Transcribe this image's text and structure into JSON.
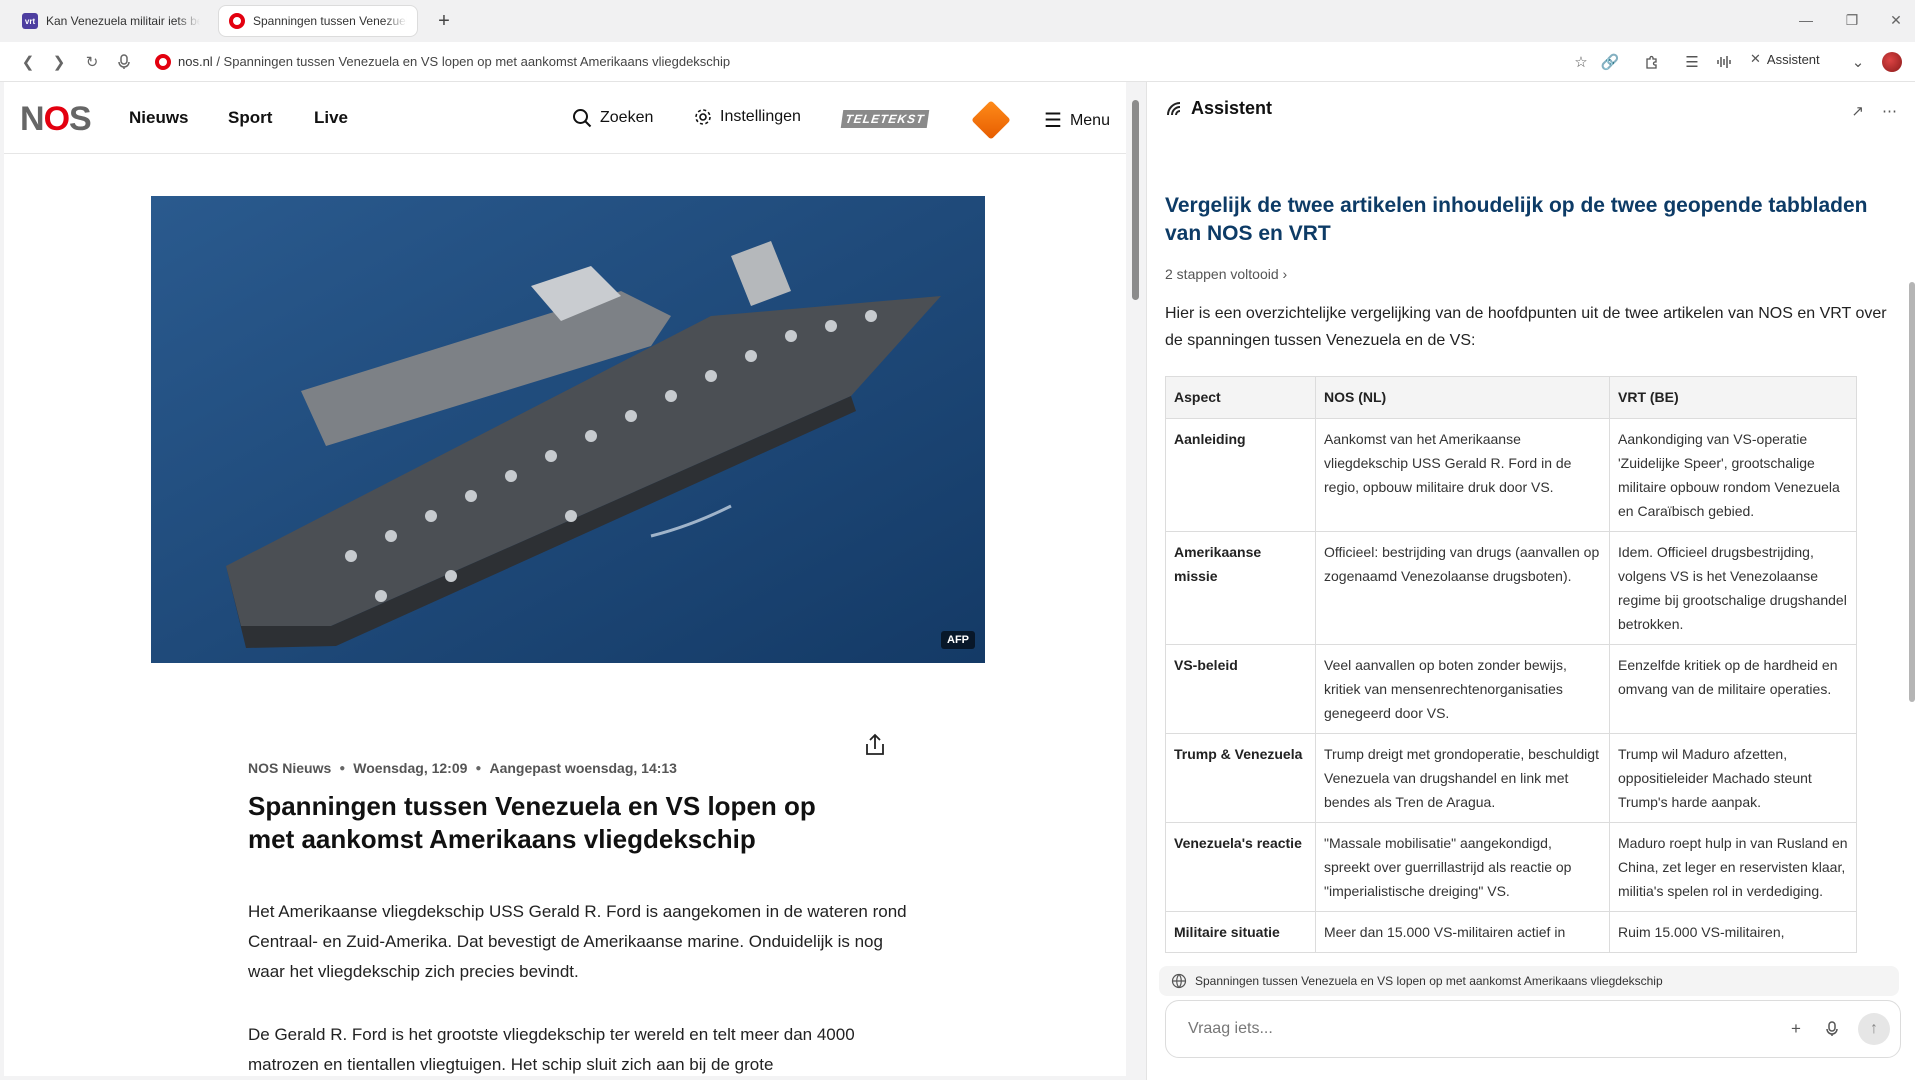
{
  "tabs": [
    {
      "title": "Kan Venezuela militair iets be",
      "favicon": "vrt-favicon-icon"
    },
    {
      "title": "Spanningen tussen Venezuela",
      "favicon": "nos-favicon-icon"
    }
  ],
  "address": {
    "host": "nos.nl",
    "path": " / Spanningen tussen Venezuela en VS lopen op met aankomst Amerikaans vliegdekschip"
  },
  "toolbar": {
    "assistant_label": "Assistent"
  },
  "nos": {
    "logo_left": "N",
    "logo_o": "O",
    "logo_right": "S",
    "nav": [
      "Nieuws",
      "Sport",
      "Live"
    ],
    "search_label": "Zoeken",
    "settings_label": "Instellingen",
    "teletekst_label": "TELETEKST",
    "menu_label": "Menu",
    "image_credit": "AFP",
    "meta_source": "NOS Nieuws",
    "meta_date": "Woensdag, 12:09",
    "meta_updated": "Aangepast woensdag, 14:13",
    "headline": "Spanningen tussen Venezuela en VS lopen op met aankomst Amerikaans vliegdekschip",
    "paragraphs": [
      "Het Amerikaanse vliegdekschip USS Gerald R. Ford is aangekomen in de wateren rond Centraal- en Zuid-Amerika. Dat bevestigt de Amerikaanse marine. Onduidelijk is nog waar het vliegdekschip zich precies bevindt.",
      "De Gerald R. Ford is het grootste vliegdekschip ter wereld en telt meer dan 4000 matrozen en tientallen vliegtuigen. Het schip sluit zich aan bij de grote"
    ]
  },
  "assistant": {
    "title": "Assistent",
    "question": "Vergelijk de twee artikelen inhoudelijk op de twee geopende tabbladen van NOS en VRT",
    "steps": "2 stappen voltooid",
    "intro": "Hier is een overzichtelijke vergelijking van de hoofdpunten uit de twee artikelen van NOS en VRT over de spanningen tussen Venezuela en de VS:",
    "table_headers": [
      "Aspect",
      "NOS (NL)",
      "VRT (BE)"
    ],
    "rows": [
      {
        "aspect": "Aanleiding",
        "nos": "Aankomst van het Amerikaanse vliegdekschip USS Gerald R. Ford in de regio, opbouw militaire druk door VS.",
        "vrt": "Aankondiging van VS-operatie 'Zuidelijke Speer', grootschalige militaire opbouw rondom Venezuela en Caraïbisch gebied."
      },
      {
        "aspect": "Amerikaanse missie",
        "nos": "Officieel: bestrijding van drugs (aanvallen op zogenaamd Venezolaanse drugsboten).",
        "vrt": "Idem. Officieel drugsbestrijding, volgens VS is het Venezolaanse regime bij grootschalige drugshandel betrokken."
      },
      {
        "aspect": "VS-beleid",
        "nos": "Veel aanvallen op boten zonder bewijs, kritiek van mensenrechtenorganisaties genegeerd door VS.",
        "vrt": "Eenzelfde kritiek op de hardheid en omvang van de militaire operaties."
      },
      {
        "aspect": "Trump & Venezuela",
        "nos": "Trump dreigt met grondoperatie, beschuldigt Venezuela van drugshandel en link met bendes als Tren de Aragua.",
        "vrt": "Trump wil Maduro afzetten, oppositieleider Machado steunt Trump's harde aanpak."
      },
      {
        "aspect": "Venezuela's reactie",
        "nos": "\"Massale mobilisatie\" aangekondigd, spreekt over guerrillastrijd als reactie op \"imperialistische dreiging\" VS.",
        "vrt": "Maduro roept hulp in van Rusland en China, zet leger en reservisten klaar, militia's spelen rol in verdediging."
      },
      {
        "aspect": "Militaire situatie",
        "nos": "Meer dan 15.000 VS-militairen actief in",
        "vrt": "Ruim 15.000 VS-militairen,"
      }
    ],
    "context_chip": "Spanningen tussen Venezuela en VS lopen op met aankomst Amerikaans vliegdekschip",
    "input_placeholder": "Vraag iets..."
  }
}
